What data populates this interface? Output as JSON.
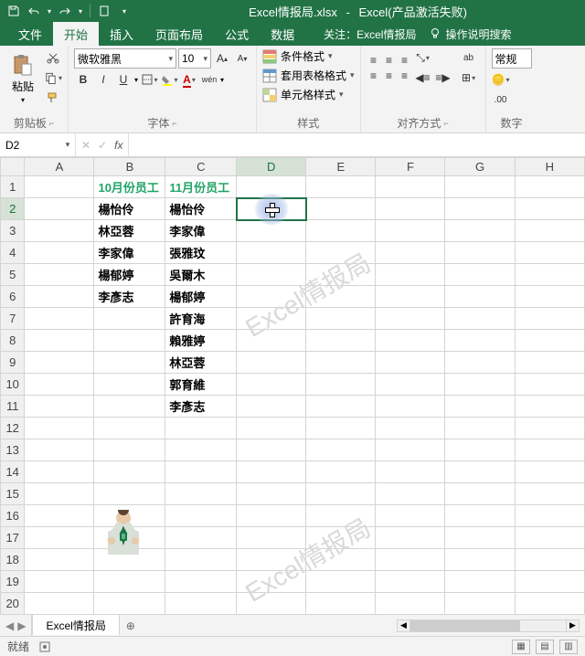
{
  "title": {
    "file": "Excel情报局.xlsx",
    "sep": "-",
    "app": "Excel(产品激活失败)"
  },
  "tabs": [
    "文件",
    "开始",
    "插入",
    "页面布局",
    "公式",
    "数据"
  ],
  "activeTab": 1,
  "help": {
    "follow": "关注：Excel情报局",
    "tellme": "操作说明搜索"
  },
  "ribbon": {
    "clipboard": {
      "title": "剪贴板",
      "paste": "粘贴"
    },
    "font": {
      "title": "字体",
      "name": "微软雅黑",
      "size": "10",
      "bold": "B",
      "italic": "I",
      "underline": "U",
      "pinyin": "wén"
    },
    "styles": {
      "title": "样式",
      "cond": "条件格式",
      "table": "套用表格格式",
      "cell": "单元格样式"
    },
    "align": {
      "title": "对齐方式",
      "wrap": "ab"
    },
    "number": {
      "title": "数字",
      "general": "常规"
    }
  },
  "formulaBar": {
    "name": "D2",
    "fx": "fx",
    "cancel": "✕",
    "confirm": "✓"
  },
  "grid": {
    "cols": [
      "A",
      "B",
      "C",
      "D",
      "E",
      "F",
      "G",
      "H"
    ],
    "rows": [
      1,
      2,
      3,
      4,
      5,
      6,
      7,
      8,
      9,
      10,
      11,
      12,
      13,
      14,
      15,
      16,
      17,
      18,
      19,
      20
    ],
    "selectedCol": 3,
    "selectedRow": 2,
    "data": {
      "B1": "10月份员工",
      "C1": "11月份员工",
      "B2": "楊怡伶",
      "C2": "楊怡伶",
      "B3": "林亞蓉",
      "C3": "李家偉",
      "B4": "李家偉",
      "C4": "張雅玟",
      "B5": "楊郁婷",
      "C5": "吳爾木",
      "B6": "李彥志",
      "C6": "楊郁婷",
      "C7": "許育海",
      "C8": "賴雅婷",
      "C9": "林亞蓉",
      "C10": "郭育維",
      "C11": "李彥志"
    },
    "headerCells": [
      "B1",
      "C1"
    ]
  },
  "watermark": "Excel情报局",
  "sheet": {
    "name": "Excel情报局"
  },
  "status": {
    "ready": "就绪"
  }
}
